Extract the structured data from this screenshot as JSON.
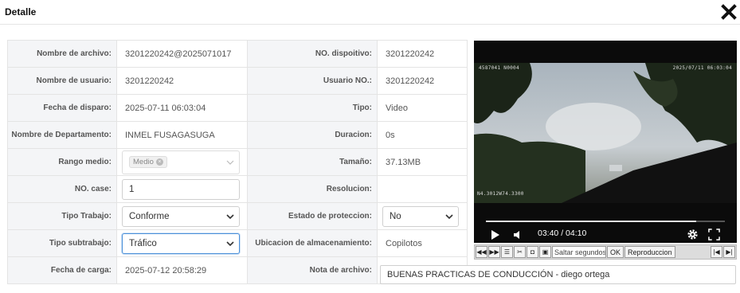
{
  "dialog": {
    "title": "Detalle",
    "close_icon": "close-icon"
  },
  "rows": [
    {
      "label": "Nombre de archivo:",
      "value": "3201220242@2025071017",
      "label2": "NO. dispoitivo:",
      "value2": "3201220242"
    },
    {
      "label": "Nombre de usuario:",
      "value": "3201220242",
      "label2": "Usuario NO.:",
      "value2": "3201220242"
    },
    {
      "label": "Fecha de disparo:",
      "value": "2025-07-11 06:03:04",
      "label2": "Tipo:",
      "value2": "Video"
    },
    {
      "label": "Nombre de Departamento:",
      "value": "INMEL FUSAGASUGA",
      "label2": "Duracion:",
      "value2": "0s"
    },
    {
      "label": "Rango medio:",
      "tag": "Medio",
      "label2": "Tamaño:",
      "value2": "37.13MB"
    },
    {
      "label": "NO. case:",
      "input_value": "1",
      "label2": "Resolucion:",
      "value2": ""
    },
    {
      "label": "Tipo Trabajo:",
      "select_value": "Conforme",
      "label2": "Estado de proteccion:",
      "select_value2": "No"
    },
    {
      "label": "Tipo subtrabajo:",
      "select_value": "Tráfico",
      "label2": "Ubicacion de almacenamiento:",
      "value2": "Copilotos"
    },
    {
      "label": "Fecha de carga:",
      "value": "2025-07-12 20:58:29",
      "label2": "Nota de archivo:",
      "nota": "BUENAS PRACTICAS DE CONDUCCIÓN - diego ortega"
    }
  ],
  "player": {
    "overlay_top_left": "4587041 N0004",
    "overlay_top_right": "2025/07/11 06:03:04",
    "overlay_bottom_left": "N4.3012W74.3300",
    "current_time": "03:40",
    "duration": "04:10",
    "progress": 0.88
  },
  "toolbar": {
    "skip_placeholder": "Saltar segundos",
    "ok_label": "OK",
    "speed_label": "Reproduccion"
  },
  "colors": {
    "accent": "#4a90d9",
    "label_bg": "#f4f5f7",
    "border": "#e4e4e4"
  }
}
